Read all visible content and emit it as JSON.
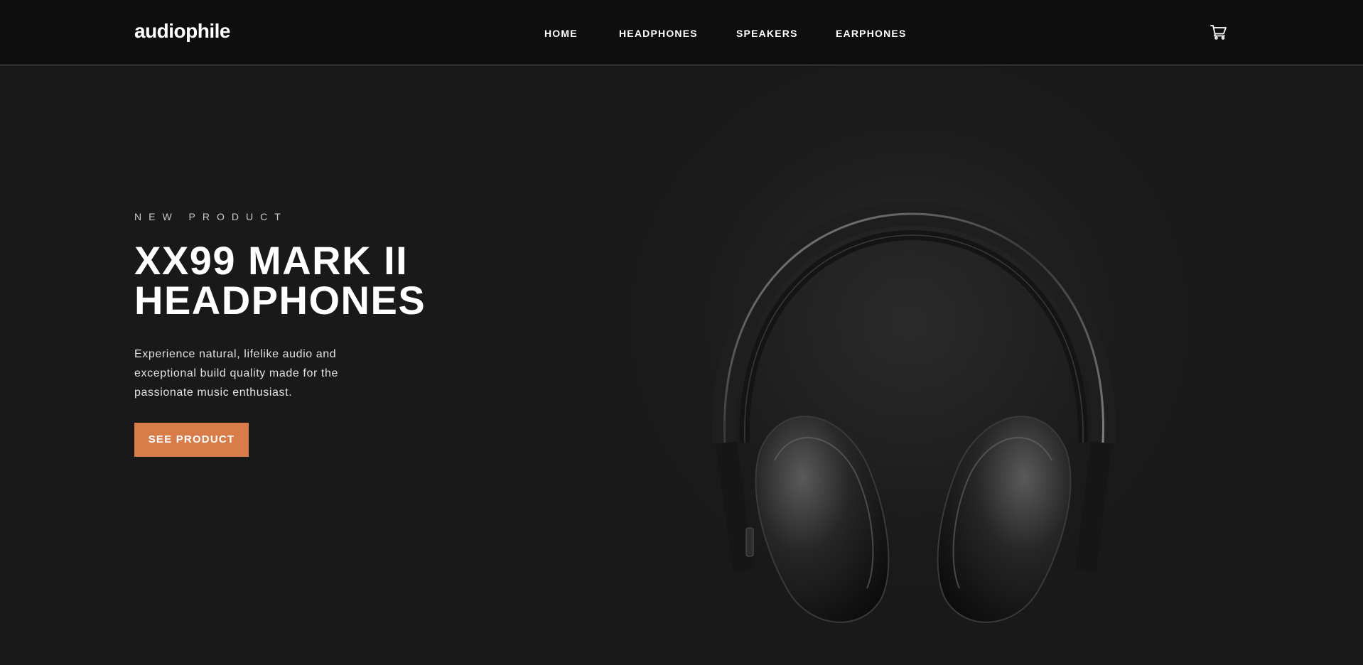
{
  "header": {
    "logo": "audiophile",
    "nav": [
      {
        "label": "HOME"
      },
      {
        "label": "HEADPHONES"
      },
      {
        "label": "SPEAKERS"
      },
      {
        "label": "EARPHONES"
      }
    ],
    "cart_icon": "cart-icon"
  },
  "hero": {
    "overline": "NEW PRODUCT",
    "title_lines": [
      "XX99 MARK II",
      "HEADPHONES"
    ],
    "description_lines": [
      "Experience natural, lifelike audio and",
      "exceptional build quality made for the",
      "passionate music enthusiast."
    ],
    "cta_label": "SEE PRODUCT",
    "image": "headphones-image"
  },
  "colors": {
    "background": "#191919",
    "header_background": "#0e0e0e",
    "accent": "#d87d4a",
    "text": "#ffffff"
  }
}
